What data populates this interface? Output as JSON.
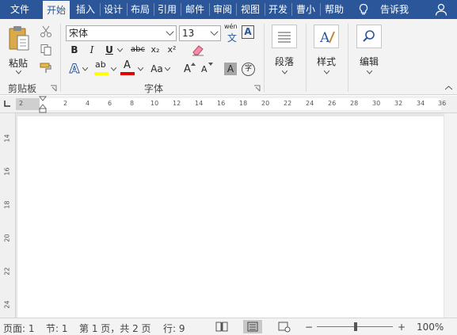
{
  "tabs": [
    {
      "label": "文件"
    },
    {
      "label": "开始"
    },
    {
      "label": "插入"
    },
    {
      "label": "设计"
    },
    {
      "label": "布局"
    },
    {
      "label": "引用"
    },
    {
      "label": "邮件"
    },
    {
      "label": "审阅"
    },
    {
      "label": "视图"
    },
    {
      "label": "开发"
    },
    {
      "label": "曹小"
    },
    {
      "label": "帮助"
    }
  ],
  "tell_me": "告诉我",
  "clipboard": {
    "paste_label": "粘贴",
    "group_label": "剪贴板"
  },
  "font": {
    "font_name": "宋体",
    "font_size": "13",
    "phonetic_top": "wén",
    "phonetic_bottom": "文",
    "char_border": "A",
    "bold": "B",
    "italic": "I",
    "underline": "U",
    "strikethrough": "abc",
    "subscript": "x₂",
    "superscript": "x²",
    "text_effects": "A",
    "highlight": "ab",
    "font_color": "A",
    "change_case": "Aa",
    "grow_font": "A",
    "shrink_font": "A",
    "char_shading": "A",
    "enclose": "字",
    "group_label": "字体"
  },
  "paragraph": {
    "label": "段落"
  },
  "styles": {
    "label": "样式"
  },
  "editing": {
    "label": "编辑"
  },
  "ruler": {
    "ticks": [
      "2",
      "2",
      "4",
      "6",
      "8",
      "10",
      "12",
      "14",
      "16",
      "18",
      "20",
      "22",
      "24",
      "26",
      "28",
      "30",
      "32",
      "34",
      "36"
    ]
  },
  "vruler": {
    "ticks": [
      "14",
      "16",
      "18",
      "20",
      "22",
      "24"
    ]
  },
  "status": {
    "page": "页面: 1",
    "section": "节: 1",
    "page_of": "第 1 页，共 2 页",
    "line": "行: 9",
    "zoom": "100%",
    "zoom_minus": "−",
    "zoom_plus": "+"
  },
  "colors": {
    "tab_bar": "#2b579a",
    "ribbon": "#f3f3f3",
    "highlight_yellow": "#ffff00",
    "font_red": "#e00000",
    "accent_blue": "#2b579a"
  }
}
